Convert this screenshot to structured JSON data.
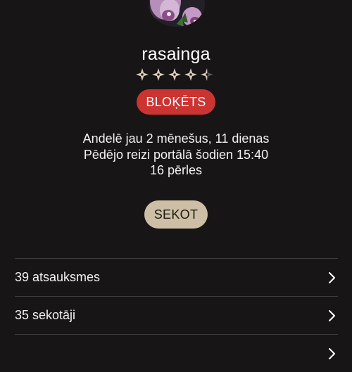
{
  "profile": {
    "username": "rasainga",
    "rating": {
      "max": 5,
      "value": 4.5
    },
    "status_badge": "BLOĶĒTS",
    "info_lines": [
      "Andelē jau 2 mēnešus, 11 dienas",
      "Pēdējo reizi portālā šodien 15:40",
      "16 pērles"
    ],
    "follow_label": "SEKOT"
  },
  "menu": {
    "items": [
      {
        "label": "39 atsauksmes"
      },
      {
        "label": "35 sekotāji"
      },
      {
        "label": ""
      }
    ]
  },
  "colors": {
    "background": "#171515",
    "badge": "#cc3431",
    "follow_button": "#cdbfa6",
    "star_filled": "#d9ccb6",
    "star_empty": "#5a5552"
  },
  "icons": {
    "rating": "diamond-star-icon",
    "menu_arrow": "chevron-right-icon"
  }
}
